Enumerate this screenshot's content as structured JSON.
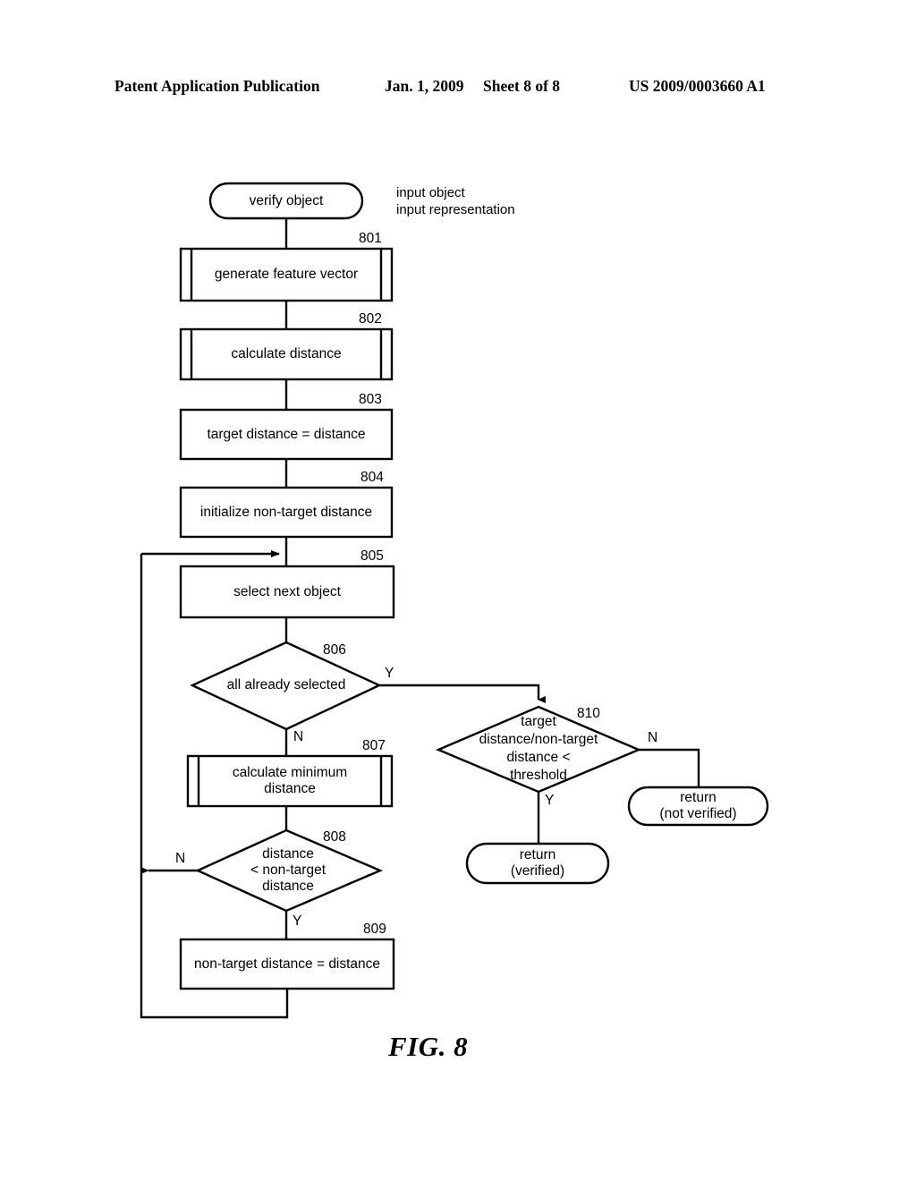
{
  "header": {
    "publication": "Patent Application Publication",
    "date": "Jan. 1, 2009",
    "sheet": "Sheet 8 of 8",
    "number": "US 2009/0003660 A1"
  },
  "figure": {
    "caption": "FIG. 8",
    "note": "input object\ninput representation"
  },
  "flowchart": {
    "nodes": [
      {
        "id": "start",
        "shape": "terminator",
        "label": "verify object",
        "ref": ""
      },
      {
        "id": "n801",
        "shape": "subroutine",
        "label": "generate feature vector",
        "ref": "801"
      },
      {
        "id": "n802",
        "shape": "subroutine",
        "label": "calculate distance",
        "ref": "802"
      },
      {
        "id": "n803",
        "shape": "process",
        "label": "target distance = distance",
        "ref": "803"
      },
      {
        "id": "n804",
        "shape": "process",
        "label": "initialize non-target distance",
        "ref": "804"
      },
      {
        "id": "n805",
        "shape": "process",
        "label": "select next object",
        "ref": "805"
      },
      {
        "id": "n806",
        "shape": "decision",
        "label": "all already selected",
        "ref": "806"
      },
      {
        "id": "n807",
        "shape": "subroutine",
        "label": "calculate minimum\ndistance",
        "ref": "807"
      },
      {
        "id": "n808",
        "shape": "decision",
        "label": "distance\n< non-target\ndistance",
        "ref": "808"
      },
      {
        "id": "n809",
        "shape": "process",
        "label": "non-target distance = distance",
        "ref": "809"
      },
      {
        "id": "n810",
        "shape": "decision",
        "label": "target\ndistance/non-target\ndistance <\nthreshold",
        "ref": "810"
      },
      {
        "id": "ret_verified",
        "shape": "terminator",
        "label": "return\n(verified)",
        "ref": ""
      },
      {
        "id": "ret_not",
        "shape": "terminator",
        "label": "return\n(not verified)",
        "ref": ""
      }
    ],
    "branch_labels": {
      "n806_yes": "Y",
      "n806_no": "N",
      "n808_no": "N",
      "n808_yes": "Y",
      "n810_yes": "Y",
      "n810_no": "N"
    }
  },
  "colors": {
    "ink": "#000000",
    "paper": "#ffffff"
  }
}
